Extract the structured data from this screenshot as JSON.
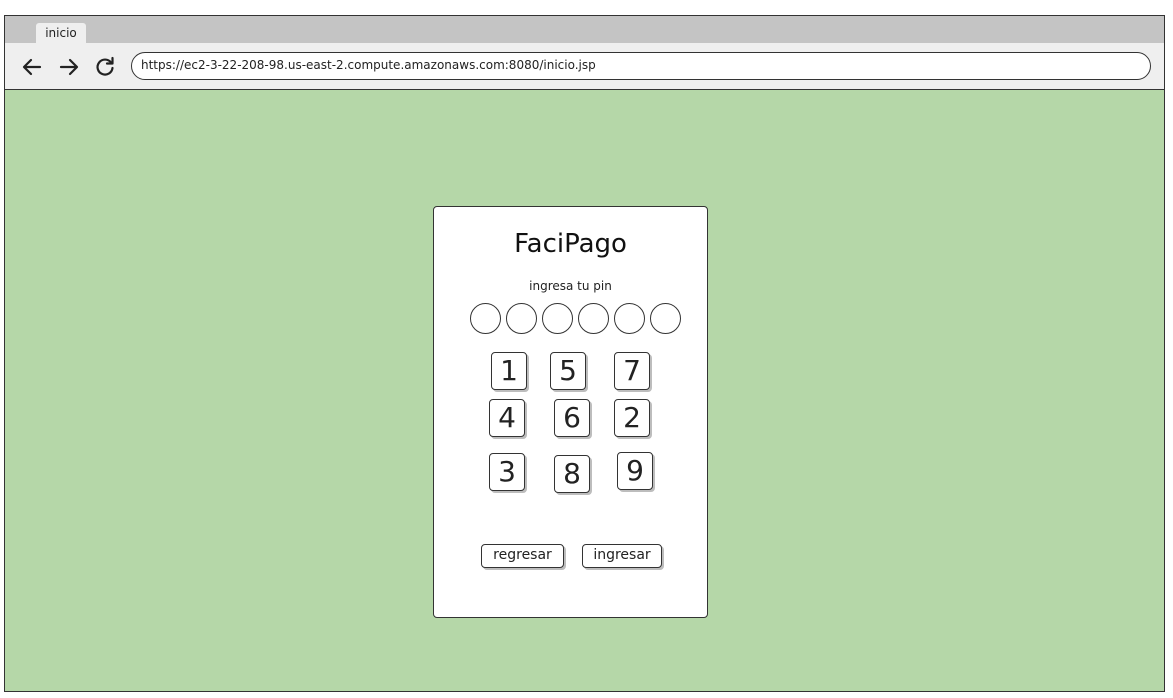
{
  "browser": {
    "tab_label": "inicio",
    "url": "https://ec2-3-22-208-98.us-east-2.compute.amazonaws.com:8080/inicio.jsp",
    "nav": {
      "back_icon": "arrow-left-icon",
      "forward_icon": "arrow-right-icon",
      "reload_icon": "reload-icon"
    }
  },
  "colors": {
    "page_background": "#b5d7a8",
    "card_background": "#ffffff",
    "tabbar": "#c4c4c4",
    "toolbar": "#efefef"
  },
  "login_card": {
    "title": "FaciPago",
    "subtitle": "ingresa tu pin",
    "pin_length": 6,
    "keypad": [
      [
        "1",
        "5",
        "7"
      ],
      [
        "4",
        "6",
        "2"
      ],
      [
        "3",
        "8",
        "9"
      ]
    ],
    "buttons": {
      "back_label": "regresar",
      "submit_label": "ingresar"
    }
  }
}
